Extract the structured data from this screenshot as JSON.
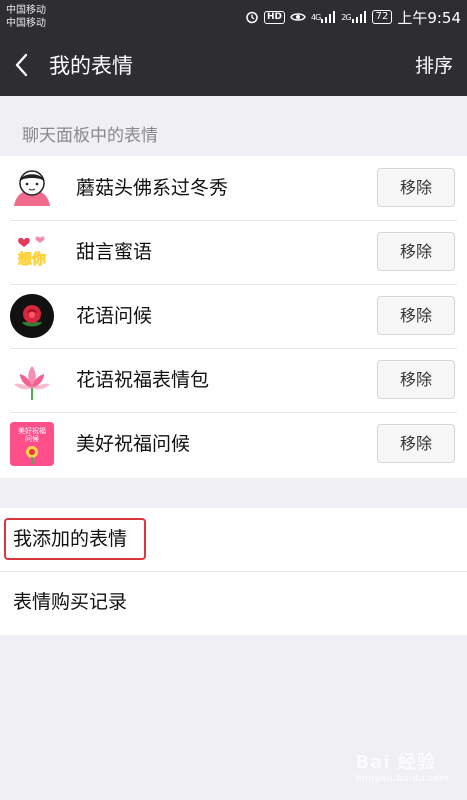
{
  "status_bar": {
    "carrier1": "中国移动",
    "carrier2": "中国移动",
    "hd": "HD",
    "net1": "4G",
    "net2": "2G",
    "battery": "72",
    "time": "上午9:54"
  },
  "nav": {
    "title": "我的表情",
    "sort_label": "排序"
  },
  "section_label": "聊天面板中的表情",
  "stickers": [
    {
      "title": "蘑菇头佛系过冬秀",
      "remove_label": "移除",
      "icon": "mushroom-head-sticker-icon"
    },
    {
      "title": "甜言蜜语",
      "remove_label": "移除",
      "icon": "sweet-words-sticker-icon"
    },
    {
      "title": "花语问候",
      "remove_label": "移除",
      "icon": "rose-sticker-icon"
    },
    {
      "title": "花语祝福表情包",
      "remove_label": "移除",
      "icon": "lotus-sticker-icon"
    },
    {
      "title": "美好祝福问候",
      "remove_label": "移除",
      "icon": "blessing-card-sticker-icon"
    }
  ],
  "menu": {
    "added": "我添加的表情",
    "purchase": "表情购买记录"
  },
  "thumb_texts": {
    "sweet": "想你",
    "card_line1": "美好祝福",
    "card_line2": "问候"
  },
  "watermark": {
    "main": "Bai 经验",
    "sub": "jingyan.baidu.com"
  },
  "colors": {
    "nav_bg": "#2d2d32",
    "page_bg": "#efeff4",
    "highlight": "#d9363e"
  }
}
